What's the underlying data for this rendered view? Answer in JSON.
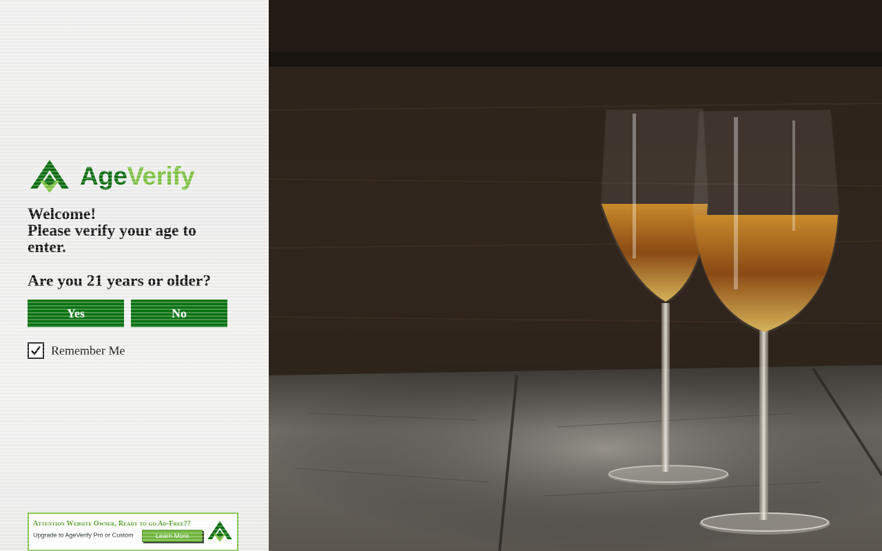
{
  "brand": {
    "name_part1": "Age",
    "name_part2": "Verify",
    "primary_color": "#0b6e0f",
    "accent_color": "#7ec242"
  },
  "gate": {
    "welcome": "Welcome!",
    "instruction_line1": "Please verify your age to",
    "instruction_line2": "enter.",
    "question": "Are you 21 years or older?",
    "yes_label": "Yes",
    "no_label": "No",
    "remember_label": "Remember Me",
    "remember_checked": true,
    "button_color": "#0a7311"
  },
  "ad_banner": {
    "line1": "Attention Website Owner, Ready to go Ad-Free??",
    "line2": "Upgrade to AgeVerify Pro or Custom",
    "button_label": "Learn More"
  },
  "background_image": {
    "subject": "two wine glasses with amber wine on a rustic wooden table"
  },
  "icons": {
    "logo": "ageverify-logo-icon",
    "checkbox": "checkmark-icon"
  }
}
